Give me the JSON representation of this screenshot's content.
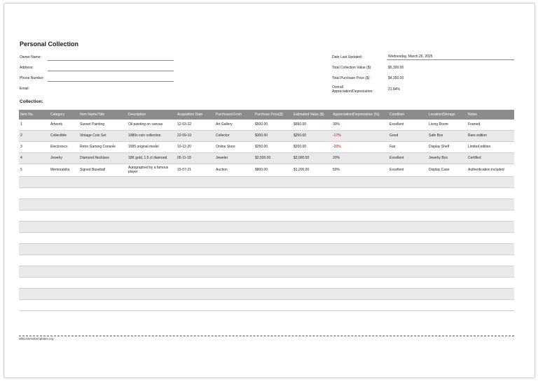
{
  "title": "Personal Collection",
  "owner_fields": [
    {
      "label": "Owner Name:"
    },
    {
      "label": "Address:"
    },
    {
      "label": "Phone Number:"
    },
    {
      "label": "Email:"
    }
  ],
  "summary_fields": [
    {
      "label": "Date Last Updated:",
      "value": "Wednesday, March 26, 2025"
    },
    {
      "label": "Total Collection Value ($):",
      "value": "$5,300.00"
    },
    {
      "label": "Total Purchase Price ($):",
      "value": "$4,350.00"
    },
    {
      "label": "Overall Appreciation/Depreciation:",
      "value": "21.84%"
    }
  ],
  "collection_label": "Collection:",
  "table": {
    "columns": [
      "Item No.",
      "Category",
      "Item Name/Title",
      "Description",
      "Acquisition Date",
      "Purchased From",
      "Purchase Price($)",
      "Estimated Value ($)",
      "Appreciation/Depreciation (%)",
      "Condition",
      "Location/Storage",
      "Notes"
    ],
    "rows": [
      [
        "1",
        "Artwork",
        "Sunset Painting",
        "Oil painting on canvas",
        "12-03-22",
        "Art Gallery",
        "$500.00",
        "$650.00",
        "30%",
        "Excellent",
        "Living Room",
        "Framed"
      ],
      [
        "2",
        "Collectible",
        "Vintage Coin Set",
        "1980s coin collection",
        "22-09-19",
        "Collector",
        "$300.00",
        "$250.00",
        "-17%",
        "Good",
        "Safe Box",
        "Rare edition"
      ],
      [
        "3",
        "Electronics",
        "Retro Gaming Console",
        "1995 original model",
        "10-12-20",
        "Online Store",
        "$250.00",
        "$200.00",
        "-20%",
        "Fair",
        "Display Shelf",
        "Limited edition"
      ],
      [
        "4",
        "Jewelry",
        "Diamond Necklace",
        "18K gold, 1.5 ct diamond",
        "05-11-18",
        "Jeweler",
        "$2,500.00",
        "$3,000.00",
        "20%",
        "Excellent",
        "Jewelry Box",
        "Certified"
      ],
      [
        "5",
        "Memorabilia",
        "Signed Baseball",
        "Autographed by a famous player",
        "15-07-21",
        "Auction",
        "$800.00",
        "$1,200.00",
        "50%",
        "Excellent",
        "Display Case",
        "Authentication included"
      ]
    ],
    "empty_row_count": 12
  },
  "footer": "allbusinesstemplates.org",
  "colors": {
    "header_bg": "#8c8c8c",
    "alt_row": "#e9e9e9",
    "negative": "#c00000"
  }
}
